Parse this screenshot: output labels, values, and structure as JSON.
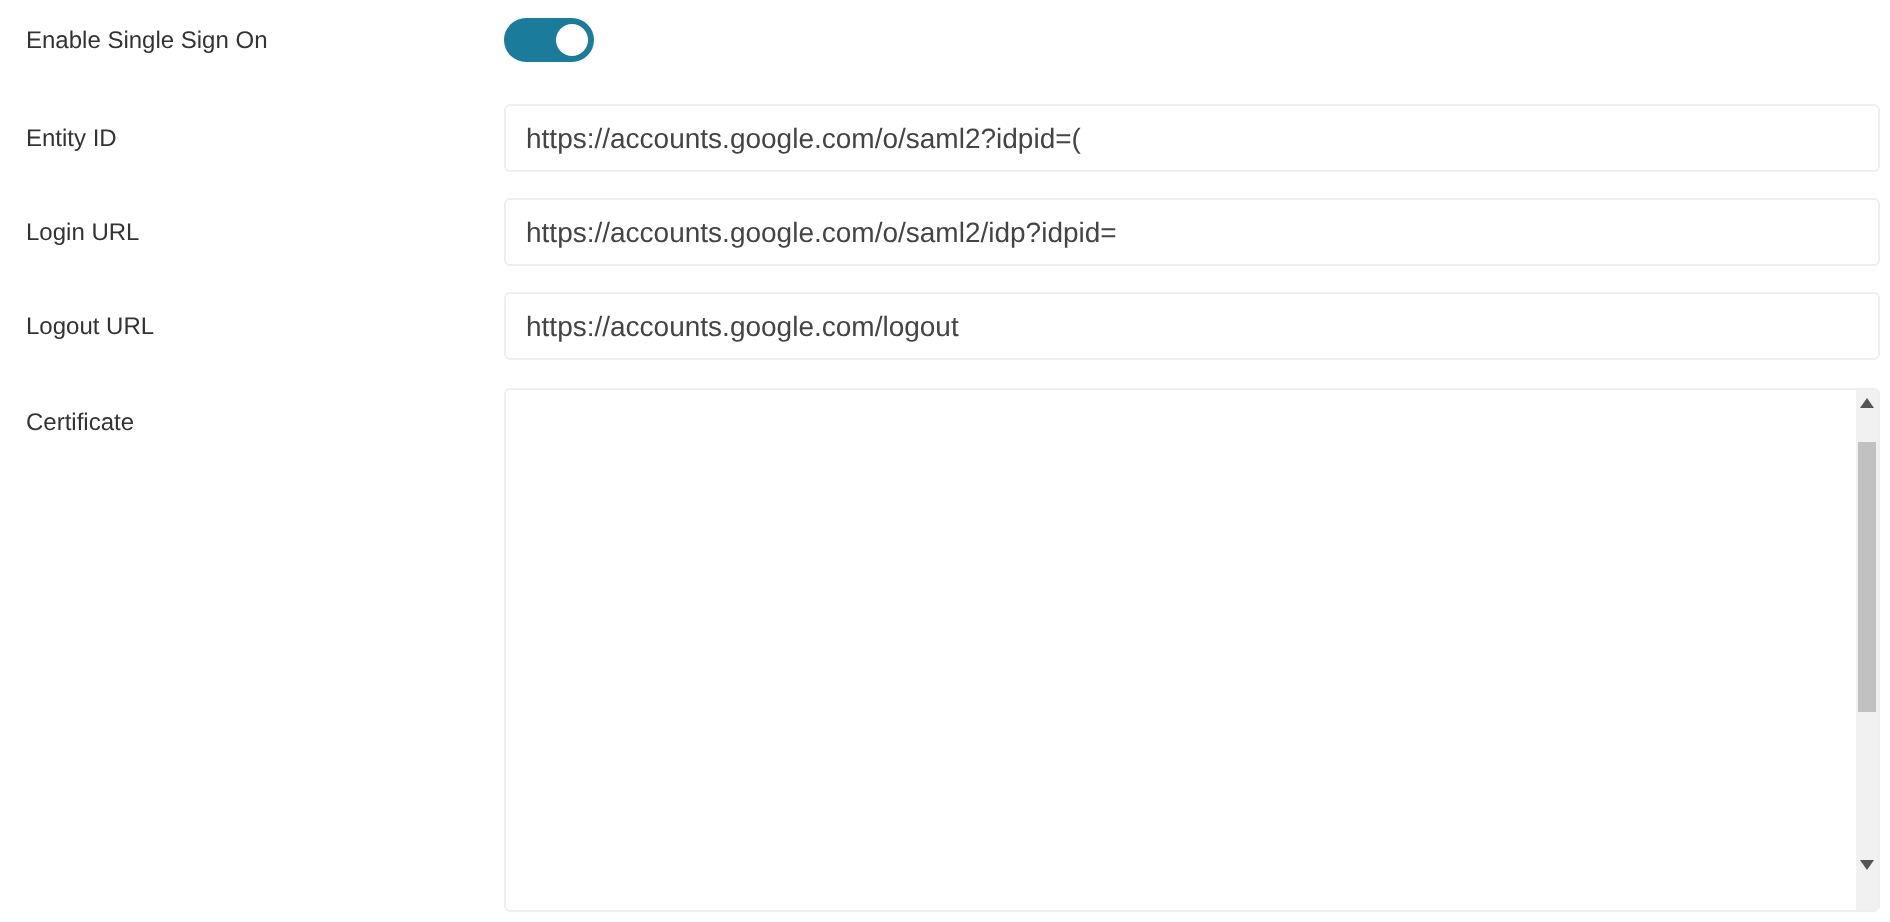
{
  "sso_toggle": {
    "label": "Enable Single Sign On",
    "on": true
  },
  "fields": [
    {
      "label": "Entity ID",
      "value": "https://accounts.google.com/o/saml2?idpid=("
    },
    {
      "label": "Login URL",
      "value": "https://accounts.google.com/o/saml2/idp?idpid="
    },
    {
      "label": "Logout URL",
      "value": "https://accounts.google.com/logout"
    }
  ],
  "certificate": {
    "label": "Certificate"
  }
}
